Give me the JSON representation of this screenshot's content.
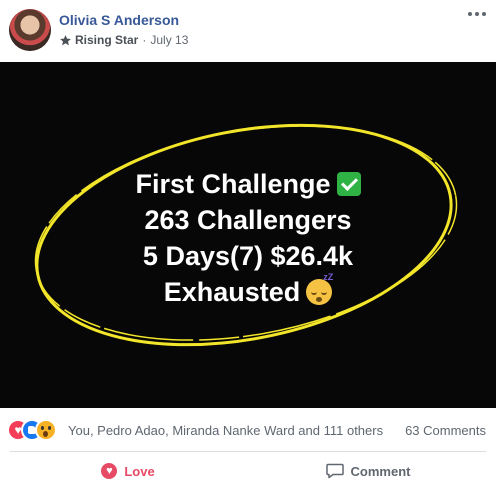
{
  "post": {
    "author": "Olivia S Anderson",
    "badge": "Rising Star",
    "separator": "·",
    "date": "July 13",
    "image_lines": [
      "First Challenge",
      "263 Challengers",
      "5 Days(7) $26.4k",
      "Exhausted"
    ],
    "icons": {
      "badge": "star-icon",
      "line1_emoji": "check-mark-emoji",
      "line4_emoji": "sleeping-face-emoji",
      "more": "more-options-icon"
    },
    "colors": {
      "name_blue": "#385898",
      "image_bg": "#070707",
      "ellipse_yellow": "#f2e52a",
      "love_red": "#e64a64"
    }
  },
  "stats": {
    "reaction_icons": [
      "love-reaction-icon",
      "like-reaction-icon",
      "wow-reaction-icon"
    ],
    "reactors": "You, Pedro Adao, Miranda Nanke Ward and 111 others",
    "comments": "63 Comments"
  },
  "actions": {
    "love_label": "Love",
    "comment_label": "Comment"
  }
}
